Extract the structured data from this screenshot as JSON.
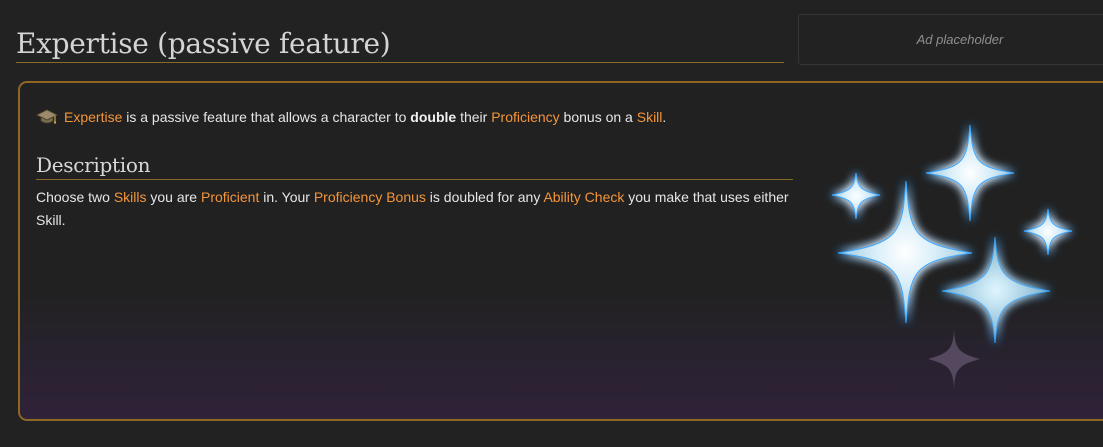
{
  "page": {
    "title": "Expertise (passive feature)"
  },
  "ad": {
    "label": "Ad placeholder"
  },
  "intro": {
    "icon": "graduation-cap-icon",
    "link_expertise": "Expertise",
    "text_1": " is a passive feature that allows a character to ",
    "bold_double": "double",
    "text_2": " their ",
    "link_proficiency": "Proficiency",
    "text_3": " bonus on a ",
    "link_skill": "Skill",
    "text_4": "."
  },
  "description": {
    "heading": "Description",
    "text_1": "Choose two ",
    "link_skills": "Skills",
    "text_2": " you are ",
    "link_proficient": "Proficient",
    "text_3": " in. Your ",
    "link_proficiency_bonus": "Proficiency Bonus",
    "text_4": " is doubled for any ",
    "link_ability_check": "Ability Check",
    "text_5": " you make that uses either Skill."
  },
  "image": {
    "icon": "sparkles-icon"
  },
  "colors": {
    "link": "#f5953a",
    "border_accent": "#8f6624",
    "background": "#222222",
    "sparkle_glow": "#3aa8ff"
  }
}
